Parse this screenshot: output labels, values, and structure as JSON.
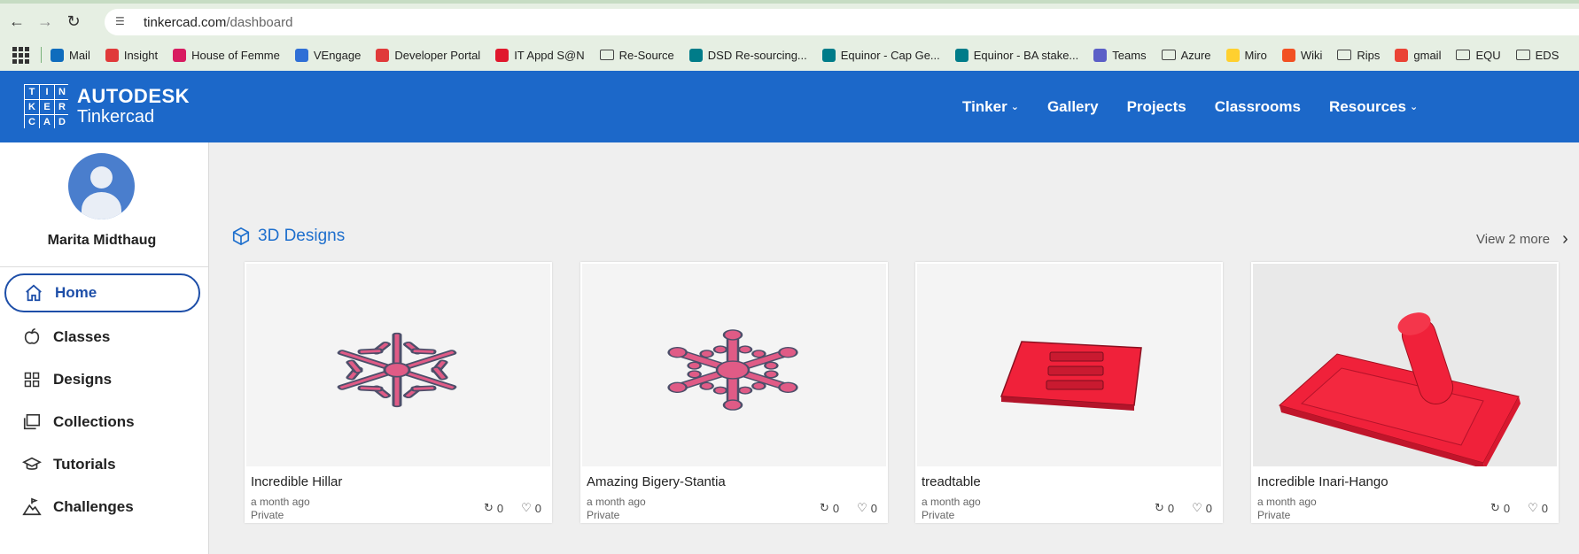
{
  "browser": {
    "url_host": "tinkercad.com",
    "url_path": "/dashboard",
    "bookmarks": [
      {
        "label": "Mail",
        "color": "#0f6cbd"
      },
      {
        "label": "Insight",
        "color": "#e03a3a"
      },
      {
        "label": "House of Femme",
        "color": "#d81b60"
      },
      {
        "label": "VEngage",
        "color": "#2f6fd6"
      },
      {
        "label": "Developer Portal",
        "color": "#e03a3a"
      },
      {
        "label": "IT Appd S@N",
        "color": "#e0182d"
      },
      {
        "label": "Re-Source",
        "folder": true
      },
      {
        "label": "DSD Re-sourcing...",
        "color": "#007c89"
      },
      {
        "label": "Equinor - Cap Ge...",
        "color": "#007c89"
      },
      {
        "label": "Equinor - BA stake...",
        "color": "#007c89"
      },
      {
        "label": "Teams",
        "color": "#5b5fc7"
      },
      {
        "label": "Azure",
        "folder": true
      },
      {
        "label": "Miro",
        "color": "#ffd02f"
      },
      {
        "label": "Wiki",
        "color": "#f25022"
      },
      {
        "label": "Rips",
        "folder": true
      },
      {
        "label": "gmail",
        "color": "#ea4335"
      },
      {
        "label": "EQU",
        "folder": true
      },
      {
        "label": "EDS",
        "folder": true
      }
    ]
  },
  "header": {
    "logo_letters": [
      "T",
      "I",
      "N",
      "K",
      "E",
      "R",
      "C",
      "A",
      "D"
    ],
    "brand": "AUTODESK",
    "product": "Tinkercad",
    "nav": [
      {
        "label": "Tinker",
        "dropdown": true
      },
      {
        "label": "Gallery",
        "dropdown": false
      },
      {
        "label": "Projects",
        "dropdown": false
      },
      {
        "label": "Classrooms",
        "dropdown": false
      },
      {
        "label": "Resources",
        "dropdown": true
      }
    ]
  },
  "sidebar": {
    "username": "Marita Midthaug",
    "items": [
      {
        "label": "Home",
        "icon": "home-icon",
        "active": true
      },
      {
        "label": "Classes",
        "icon": "apple-icon"
      },
      {
        "label": "Designs",
        "icon": "grid-icon"
      },
      {
        "label": "Collections",
        "icon": "collections-icon"
      },
      {
        "label": "Tutorials",
        "icon": "graduation-cap-icon"
      },
      {
        "label": "Challenges",
        "icon": "mountain-flag-icon"
      }
    ]
  },
  "main": {
    "section_title": "3D Designs",
    "view_more": "View 2 more",
    "cards": [
      {
        "name": "Incredible Hillar",
        "time": "a month ago",
        "privacy": "Private",
        "remixes": "0",
        "likes": "0",
        "thumb": "snowflake-outline"
      },
      {
        "name": "Amazing Bigery-Stantia",
        "time": "a month ago",
        "privacy": "Private",
        "remixes": "0",
        "likes": "0",
        "thumb": "snowflake-round"
      },
      {
        "name": "treadtable",
        "time": "a month ago",
        "privacy": "Private",
        "remixes": "0",
        "likes": "0",
        "thumb": "red-plate"
      },
      {
        "name": "Incredible Inari-Hango",
        "time": "a month ago",
        "privacy": "Private",
        "remixes": "0",
        "likes": "0",
        "thumb": "red-stamp"
      }
    ]
  },
  "colors": {
    "header_blue": "#1c68c9",
    "active_nav": "#1d4ea8",
    "design_pink": "#e05b86",
    "design_red": "#f0213a"
  }
}
